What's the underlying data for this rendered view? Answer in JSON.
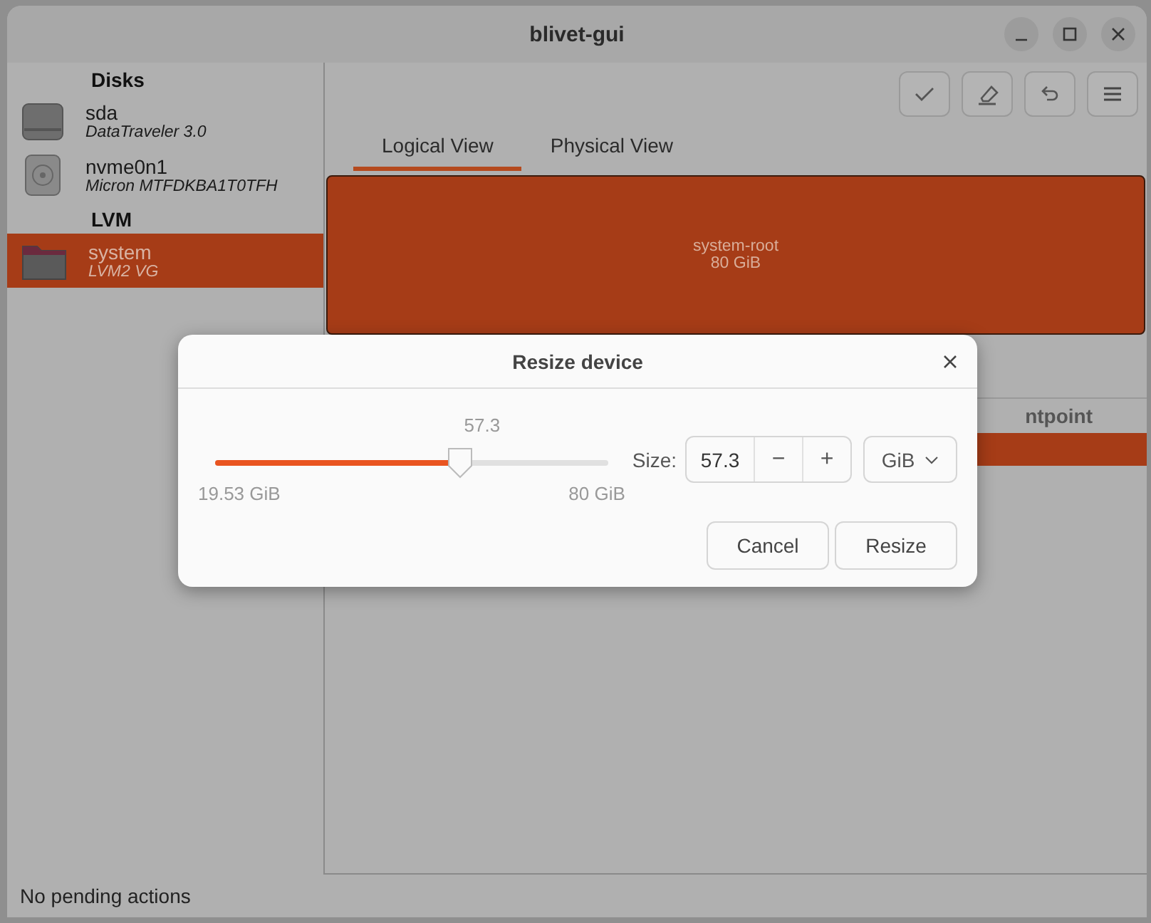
{
  "window": {
    "title": "blivet-gui"
  },
  "sidebar": {
    "groups": [
      {
        "heading": "Disks",
        "items": [
          {
            "kind": "disk",
            "name": "sda",
            "description": "DataTraveler 3.0",
            "selected": false
          },
          {
            "kind": "ssd",
            "name": "nvme0n1",
            "description": "Micron MTFDKBA1T0TFH",
            "selected": false
          }
        ]
      },
      {
        "heading": "LVM",
        "items": [
          {
            "kind": "folder",
            "name": "system",
            "description": "LVM2 VG",
            "selected": true
          }
        ]
      }
    ]
  },
  "toolbar": [
    {
      "kind": "apply"
    },
    {
      "kind": "clear"
    },
    {
      "kind": "undo"
    },
    {
      "kind": "menu"
    }
  ],
  "tabs": [
    {
      "label": "Logical View",
      "selected": true
    },
    {
      "label": "Physical View",
      "selected": false
    }
  ],
  "logical_view": {
    "blocks": [
      {
        "name": "system-root",
        "size": "80 GiB",
        "selected": true
      }
    ]
  },
  "table": {
    "columns": [
      {
        "label": "ntpoint"
      }
    ],
    "rows": [
      {
        "selected": true
      }
    ]
  },
  "status_bar": "No pending actions",
  "dialog": {
    "title": "Resize device",
    "slider": {
      "reading": "57.3",
      "level": 0.625,
      "min_label": "19.53 GiB",
      "max_label": "80 GiB"
    },
    "size_label": "Size:",
    "size_value": "57.3",
    "minus": "−",
    "plus": "+",
    "unit": "GiB",
    "buttons": [
      "Cancel",
      "Resize"
    ]
  }
}
